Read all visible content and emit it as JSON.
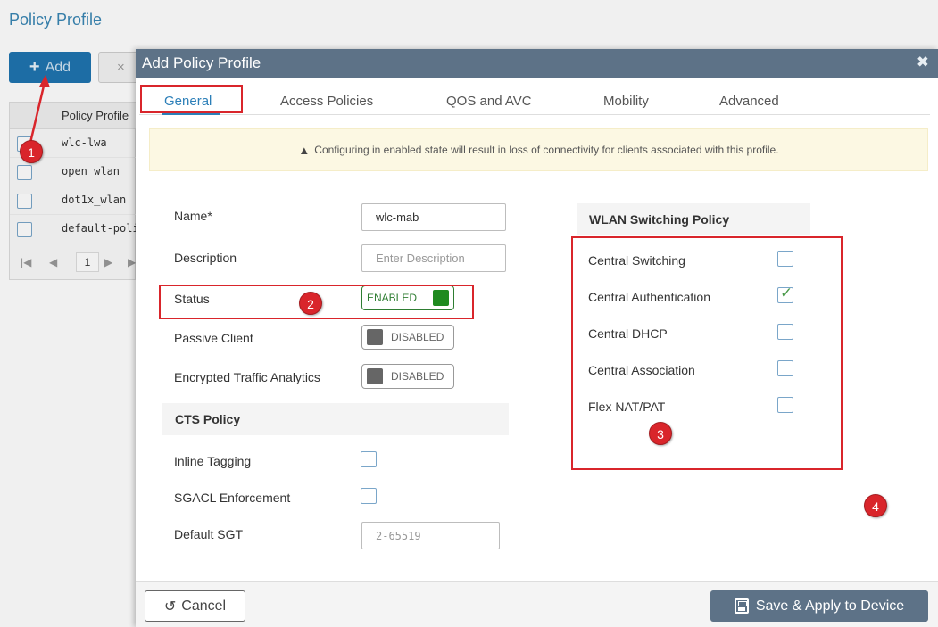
{
  "background": {
    "title": "Policy Profile",
    "add_button": "Add",
    "delete_icon": "×",
    "table_header": "Policy Profile",
    "rows": [
      "wlc-lwa",
      "open_wlan",
      "dot1x_wlan",
      "default-policy"
    ],
    "pager": {
      "first": "|◀",
      "prev": "◀",
      "page": "1",
      "next": "▶",
      "last": "▶"
    }
  },
  "modal": {
    "title": "Add Policy Profile",
    "close_icon": "✖",
    "tabs": [
      "General",
      "Access Policies",
      "QOS and AVC",
      "Mobility",
      "Advanced"
    ],
    "active_tab": "General",
    "warning": "Configuring in enabled state will result in loss of connectivity for clients associated with this profile.",
    "warning_icon": "▲",
    "form": {
      "name_label": "Name*",
      "name_value": "wlc-mab",
      "description_label": "Description",
      "description_placeholder": "Enter Description",
      "status_label": "Status",
      "status_value": "ENABLED",
      "passive_client_label": "Passive Client",
      "passive_client_value": "DISABLED",
      "eta_label": "Encrypted Traffic Analytics",
      "eta_value": "DISABLED"
    },
    "cts": {
      "title": "CTS Policy",
      "inline_tagging_label": "Inline Tagging",
      "sgacl_label": "SGACL Enforcement",
      "default_sgt_label": "Default SGT",
      "default_sgt_placeholder": "2-65519"
    },
    "wlan": {
      "title": "WLAN Switching Policy",
      "items": [
        {
          "label": "Central Switching",
          "checked": false
        },
        {
          "label": "Central Authentication",
          "checked": true
        },
        {
          "label": "Central DHCP",
          "checked": false
        },
        {
          "label": "Central Association",
          "checked": false
        },
        {
          "label": "Flex NAT/PAT",
          "checked": false
        }
      ]
    },
    "footer": {
      "cancel": "Cancel",
      "cancel_icon": "↺",
      "save": "Save & Apply to Device"
    }
  },
  "annotations": {
    "b1": "1",
    "b2": "2",
    "b3": "3",
    "b4": "4"
  },
  "colors": {
    "annotation_red": "#d9252b",
    "header": "#5d7287",
    "accent": "#2c7fb8",
    "enabled_green": "#1f8a1f"
  }
}
